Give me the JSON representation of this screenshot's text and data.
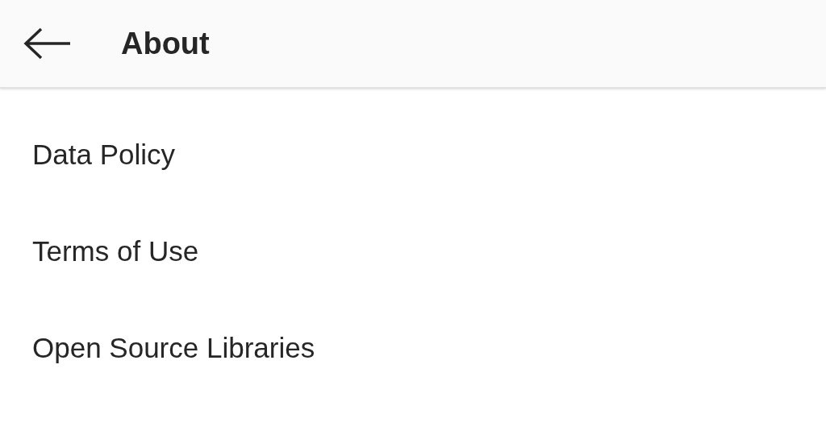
{
  "header": {
    "title": "About"
  },
  "items": [
    "Data Policy",
    "Terms of Use",
    "Open Source Libraries"
  ]
}
